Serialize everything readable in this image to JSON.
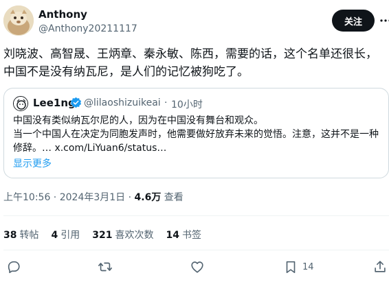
{
  "author": {
    "display_name": "Anthony",
    "handle": "@Anthony20211117",
    "follow_label": "关注"
  },
  "tweet": {
    "text": "刘晓波、高智晟、王炳章、秦永敏、陈西，需要的话，这个名单还很长，中国不是没有纳瓦尼，是人们的记忆被狗吃了。"
  },
  "quote": {
    "name": "Lee1ng",
    "handle": "@lilaoshizuikeai",
    "dot": "·",
    "time": "10小时",
    "line1": "中国没有类似纳瓦尔尼的人，因为在中国没有舞台和观众。",
    "line2": "当一个中国人在决定为同胞发声时，他需要做好放弃未来的觉悟。注意，这并不是一种修辞。… x.com/LiYuan6/status…",
    "show_more": "显示更多"
  },
  "meta": {
    "time": "上午10:56",
    "sep": " · ",
    "date": "2024年3月1日",
    "views_num": "4.6万",
    "views_label": " 查看"
  },
  "stats": {
    "retweets_num": "38",
    "retweets_label": "转帖",
    "quotes_num": "4",
    "quotes_label": "引用",
    "likes_num": "321",
    "likes_label": "喜欢次数",
    "bookmarks_num": "14",
    "bookmarks_label": "书签"
  },
  "actions": {
    "reply_icon": "reply-icon",
    "retweet_icon": "retweet-icon",
    "like_icon": "heart-icon",
    "bookmark_icon": "bookmark-icon",
    "bookmark_count": "14",
    "share_icon": "share-icon"
  },
  "colors": {
    "accent": "#1d9bf0",
    "text": "#0f1419",
    "muted": "#536471",
    "border": "#cfd9de"
  }
}
